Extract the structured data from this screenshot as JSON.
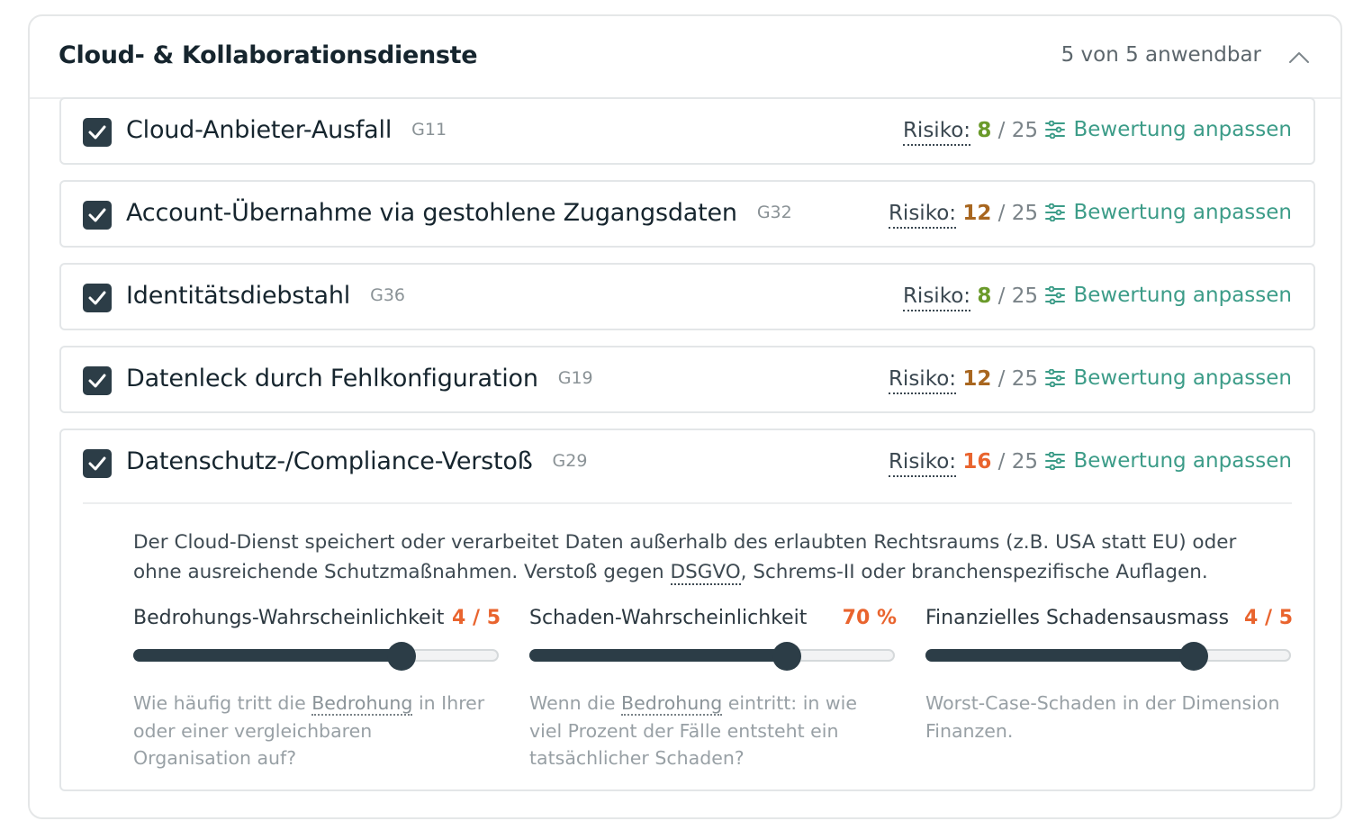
{
  "section": {
    "title": "Cloud- & Kollaborationsdienste",
    "count_label": "5 von 5 anwendbar"
  },
  "labels": {
    "risk": "Risiko:",
    "adjust": "Bewertung anpassen"
  },
  "colors": {
    "low": "#6a9a2a",
    "medium": "#a8661f",
    "high": "#e9642e",
    "accent": "#3c9c88",
    "dark": "#2c3d47"
  },
  "threats": [
    {
      "title": "Cloud-Anbieter-Ausfall",
      "code": "G11",
      "risk": "8",
      "risk_max": "/ 25",
      "checked": true
    },
    {
      "title": "Account-Übernahme via gestohlene Zugangsdaten",
      "code": "G32",
      "risk": "12",
      "risk_max": "/ 25",
      "checked": true
    },
    {
      "title": "Identitätsdiebstahl",
      "code": "G36",
      "risk": "8",
      "risk_max": "/ 25",
      "checked": true
    },
    {
      "title": "Datenleck durch Fehlkonfiguration",
      "code": "G19",
      "risk": "12",
      "risk_max": "/ 25",
      "checked": true
    },
    {
      "title": "Datenschutz-/Compliance-Verstoß",
      "code": "G29",
      "risk": "16",
      "risk_max": "/ 25",
      "checked": true
    }
  ],
  "expanded": {
    "desc_part1": "Der Cloud-Dienst speichert oder verarbeitet Daten außerhalb des erlaubten Rechtsraums (z.B. USA statt EU) oder ohne ausreichende Schutzmaßnahmen. Verstoß gegen ",
    "desc_term": "DSGVO",
    "desc_part2": ", Schrems-II oder branchenspezifische Auflagen.",
    "sliders": [
      {
        "label": "Bedrohungs-Wahrscheinlichkeit",
        "value": "4 / 5",
        "fraction": 0.73,
        "help_a": "Wie häufig tritt die ",
        "help_term": "Bedrohung",
        "help_b": " in Ihrer oder einer vergleichbaren Organisation auf?"
      },
      {
        "label": "Schaden-Wahrscheinlichkeit",
        "value": "70 %",
        "fraction": 0.7,
        "help_a": "Wenn die ",
        "help_term": "Bedrohung",
        "help_b": " eintritt: in wie viel Prozent der Fälle entsteht ein tatsächlicher Schaden?"
      },
      {
        "label": "Finanzielles Schadensausmass",
        "value": "4 / 5",
        "fraction": 0.73,
        "help_a": "Worst-Case-Schaden in der Dimension Finanzen.",
        "help_term": "",
        "help_b": ""
      }
    ]
  }
}
